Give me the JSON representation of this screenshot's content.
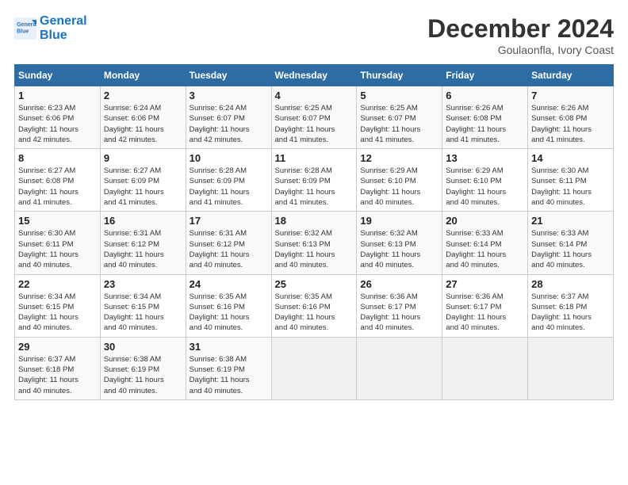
{
  "header": {
    "logo_line1": "General",
    "logo_line2": "Blue",
    "month": "December 2024",
    "location": "Goulaonfla, Ivory Coast"
  },
  "days_of_week": [
    "Sunday",
    "Monday",
    "Tuesday",
    "Wednesday",
    "Thursday",
    "Friday",
    "Saturday"
  ],
  "weeks": [
    [
      {
        "day": "1",
        "info": "Sunrise: 6:23 AM\nSunset: 6:06 PM\nDaylight: 11 hours\nand 42 minutes."
      },
      {
        "day": "2",
        "info": "Sunrise: 6:24 AM\nSunset: 6:06 PM\nDaylight: 11 hours\nand 42 minutes."
      },
      {
        "day": "3",
        "info": "Sunrise: 6:24 AM\nSunset: 6:07 PM\nDaylight: 11 hours\nand 42 minutes."
      },
      {
        "day": "4",
        "info": "Sunrise: 6:25 AM\nSunset: 6:07 PM\nDaylight: 11 hours\nand 41 minutes."
      },
      {
        "day": "5",
        "info": "Sunrise: 6:25 AM\nSunset: 6:07 PM\nDaylight: 11 hours\nand 41 minutes."
      },
      {
        "day": "6",
        "info": "Sunrise: 6:26 AM\nSunset: 6:08 PM\nDaylight: 11 hours\nand 41 minutes."
      },
      {
        "day": "7",
        "info": "Sunrise: 6:26 AM\nSunset: 6:08 PM\nDaylight: 11 hours\nand 41 minutes."
      }
    ],
    [
      {
        "day": "8",
        "info": "Sunrise: 6:27 AM\nSunset: 6:08 PM\nDaylight: 11 hours\nand 41 minutes."
      },
      {
        "day": "9",
        "info": "Sunrise: 6:27 AM\nSunset: 6:09 PM\nDaylight: 11 hours\nand 41 minutes."
      },
      {
        "day": "10",
        "info": "Sunrise: 6:28 AM\nSunset: 6:09 PM\nDaylight: 11 hours\nand 41 minutes."
      },
      {
        "day": "11",
        "info": "Sunrise: 6:28 AM\nSunset: 6:09 PM\nDaylight: 11 hours\nand 41 minutes."
      },
      {
        "day": "12",
        "info": "Sunrise: 6:29 AM\nSunset: 6:10 PM\nDaylight: 11 hours\nand 40 minutes."
      },
      {
        "day": "13",
        "info": "Sunrise: 6:29 AM\nSunset: 6:10 PM\nDaylight: 11 hours\nand 40 minutes."
      },
      {
        "day": "14",
        "info": "Sunrise: 6:30 AM\nSunset: 6:11 PM\nDaylight: 11 hours\nand 40 minutes."
      }
    ],
    [
      {
        "day": "15",
        "info": "Sunrise: 6:30 AM\nSunset: 6:11 PM\nDaylight: 11 hours\nand 40 minutes."
      },
      {
        "day": "16",
        "info": "Sunrise: 6:31 AM\nSunset: 6:12 PM\nDaylight: 11 hours\nand 40 minutes."
      },
      {
        "day": "17",
        "info": "Sunrise: 6:31 AM\nSunset: 6:12 PM\nDaylight: 11 hours\nand 40 minutes."
      },
      {
        "day": "18",
        "info": "Sunrise: 6:32 AM\nSunset: 6:13 PM\nDaylight: 11 hours\nand 40 minutes."
      },
      {
        "day": "19",
        "info": "Sunrise: 6:32 AM\nSunset: 6:13 PM\nDaylight: 11 hours\nand 40 minutes."
      },
      {
        "day": "20",
        "info": "Sunrise: 6:33 AM\nSunset: 6:14 PM\nDaylight: 11 hours\nand 40 minutes."
      },
      {
        "day": "21",
        "info": "Sunrise: 6:33 AM\nSunset: 6:14 PM\nDaylight: 11 hours\nand 40 minutes."
      }
    ],
    [
      {
        "day": "22",
        "info": "Sunrise: 6:34 AM\nSunset: 6:15 PM\nDaylight: 11 hours\nand 40 minutes."
      },
      {
        "day": "23",
        "info": "Sunrise: 6:34 AM\nSunset: 6:15 PM\nDaylight: 11 hours\nand 40 minutes."
      },
      {
        "day": "24",
        "info": "Sunrise: 6:35 AM\nSunset: 6:16 PM\nDaylight: 11 hours\nand 40 minutes."
      },
      {
        "day": "25",
        "info": "Sunrise: 6:35 AM\nSunset: 6:16 PM\nDaylight: 11 hours\nand 40 minutes."
      },
      {
        "day": "26",
        "info": "Sunrise: 6:36 AM\nSunset: 6:17 PM\nDaylight: 11 hours\nand 40 minutes."
      },
      {
        "day": "27",
        "info": "Sunrise: 6:36 AM\nSunset: 6:17 PM\nDaylight: 11 hours\nand 40 minutes."
      },
      {
        "day": "28",
        "info": "Sunrise: 6:37 AM\nSunset: 6:18 PM\nDaylight: 11 hours\nand 40 minutes."
      }
    ],
    [
      {
        "day": "29",
        "info": "Sunrise: 6:37 AM\nSunset: 6:18 PM\nDaylight: 11 hours\nand 40 minutes."
      },
      {
        "day": "30",
        "info": "Sunrise: 6:38 AM\nSunset: 6:19 PM\nDaylight: 11 hours\nand 40 minutes."
      },
      {
        "day": "31",
        "info": "Sunrise: 6:38 AM\nSunset: 6:19 PM\nDaylight: 11 hours\nand 40 minutes."
      },
      null,
      null,
      null,
      null
    ]
  ]
}
